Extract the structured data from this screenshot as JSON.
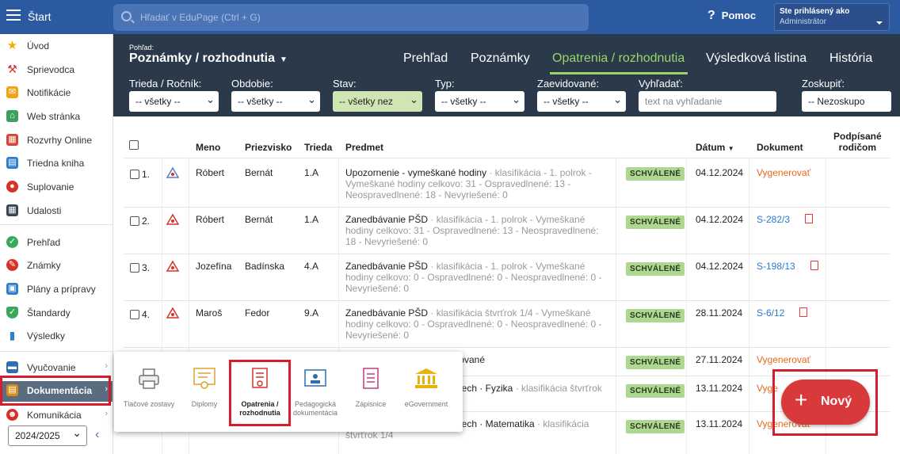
{
  "topbar": {
    "start": "Štart",
    "search_placeholder": "Hľadať v EduPage (Ctrl + G)",
    "help": "Pomoc",
    "user_line1": "Ste prihlásený ako",
    "user_line2": "Administrátor"
  },
  "sidebar": {
    "items": [
      {
        "label": "Úvod",
        "icon": "star-icon"
      },
      {
        "label": "Sprievodca",
        "icon": "wand-icon"
      },
      {
        "label": "Notifikácie",
        "icon": "envelope-icon"
      },
      {
        "label": "Web stránka",
        "icon": "home-icon"
      },
      {
        "label": "Rozvrhy Online",
        "icon": "timetable-icon"
      },
      {
        "label": "Triedna kniha",
        "icon": "book-icon"
      },
      {
        "label": "Suplovanie",
        "icon": "substitution-icon"
      },
      {
        "label": "Udalosti",
        "icon": "calendar-icon"
      },
      {
        "label": "Prehľad",
        "icon": "check-icon"
      },
      {
        "label": "Známky",
        "icon": "grades-icon"
      },
      {
        "label": "Plány a prípravy",
        "icon": "briefcase-icon"
      },
      {
        "label": "Štandardy",
        "icon": "shield-icon"
      },
      {
        "label": "Výsledky",
        "icon": "bar-chart-icon"
      },
      {
        "label": "Vyučovanie",
        "icon": "teaching-icon"
      },
      {
        "label": "Dokumentácia",
        "icon": "documents-icon"
      },
      {
        "label": "Komunikácia",
        "icon": "chat-icon"
      }
    ],
    "year": "2024/2025"
  },
  "header": {
    "pohlad_small": "Pohľad:",
    "pohlad_title": "Poznámky / rozhodnutia",
    "tabs": [
      "Prehľad",
      "Poznámky",
      "Opatrenia / rozhodnutia",
      "Výsledková listina",
      "História"
    ],
    "filters": [
      {
        "label": "Trieda / Ročník:",
        "value": "-- všetky --"
      },
      {
        "label": "Obdobie:",
        "value": "-- všetky --"
      },
      {
        "label": "Stav:",
        "value": "-- všetky nez"
      },
      {
        "label": "Typ:",
        "value": "-- všetky --"
      },
      {
        "label": "Zaevidované:",
        "value": "-- všetky --"
      },
      {
        "label": "Vyhľadať:",
        "placeholder": "text na vyhľadanie"
      },
      {
        "label": "Zoskupiť:",
        "value": "-- Nezoskupo"
      }
    ]
  },
  "table": {
    "headers": {
      "meno": "Meno",
      "priezvisko": "Priezvisko",
      "trieda": "Trieda",
      "predmet": "Predmet",
      "datum": "Dátum",
      "dokument": "Dokument",
      "podpisane1": "Podpísané",
      "podpisane2": "rodičom"
    },
    "rows": [
      {
        "num": "1.",
        "meno": "Róbert",
        "priezvisko": "Bernát",
        "trieda": "1.A",
        "title": "Upozornenie - vymeškané hodiny",
        "detail": " · klasifikácia - 1. polrok - Vymeškané hodiny celkovo: 31 - Ospravedlnené: 13 - Neospravedlnené: 18 - Nevyriešené: 0",
        "status": "SCHVÁLENÉ",
        "date": "04.12.2024",
        "doc": "Vygenerovať",
        "doc_type": "gen"
      },
      {
        "num": "2.",
        "meno": "Róbert",
        "priezvisko": "Bernát",
        "trieda": "1.A",
        "title": "Zanedbávanie PŠD",
        "detail": " · klasifikácia - 1. polrok - Vymeškané hodiny celkovo: 31 - Ospravedlnené: 13 - Neospravedlnené: 18 - Nevyriešené: 0",
        "status": "SCHVÁLENÉ",
        "date": "04.12.2024",
        "doc": "S-282/3",
        "doc_type": "link"
      },
      {
        "num": "3.",
        "meno": "Jozefína",
        "priezvisko": "Badínska",
        "trieda": "4.A",
        "title": "Zanedbávanie PŠD",
        "detail": " · klasifikácia - 1. polrok - Vymeškané hodiny celkovo: 0 - Ospravedlnené: 0 - Neospravedlnené: 0 - Nevyriešené: 0",
        "status": "SCHVÁLENÉ",
        "date": "04.12.2024",
        "doc": "S-198/13",
        "doc_type": "link"
      },
      {
        "num": "4.",
        "meno": "Maroš",
        "priezvisko": "Fedor",
        "trieda": "9.A",
        "title": "Zanedbávanie PŠD",
        "detail": " · klasifikácia štvrťrok 1/4 - Vymeškané hodiny celkovo: 0 - Ospravedlnené: 0 - Neospravedlnené: 0 - Nevyriešené: 0",
        "status": "SCHVÁLENÉ",
        "date": "28.11.2024",
        "doc": "S-6/12",
        "doc_type": "link"
      },
      {
        "title": "tované",
        "detail": "",
        "status": "SCHVÁLENÉ",
        "date": "27.11.2024",
        "doc": "Vygenerovať",
        "doc_type": "gen"
      },
      {
        "title": "pech · Fyzika",
        "detail": " · klasifikácia štvrťrok",
        "status": "SCHVÁLENÉ",
        "date": "13.11.2024",
        "doc": "Vyge",
        "doc_type": "gen"
      },
      {
        "title": "pech · Matematika",
        "detail": " · klasifikácia",
        "extra": "štvrťrok 1/4",
        "status": "SCHVÁLENÉ",
        "date": "13.11.2024",
        "doc": "Vygenerovať",
        "doc_type": "gen"
      }
    ]
  },
  "popup": {
    "items": [
      "Tlačové zostavy",
      "Diplomy",
      "Opatrenia / rozhodnutia",
      "Pedagogická dokumentácia",
      "Zápisnice",
      "eGovernment"
    ]
  },
  "fab": {
    "label": "Nový"
  },
  "colors": {
    "topbar": "#2c5aa0",
    "header": "#2b3a4a",
    "accent_green": "#9ad46b",
    "badge": "#aed891",
    "highlight_red": "#d51d2b",
    "fab": "#d8393a"
  }
}
